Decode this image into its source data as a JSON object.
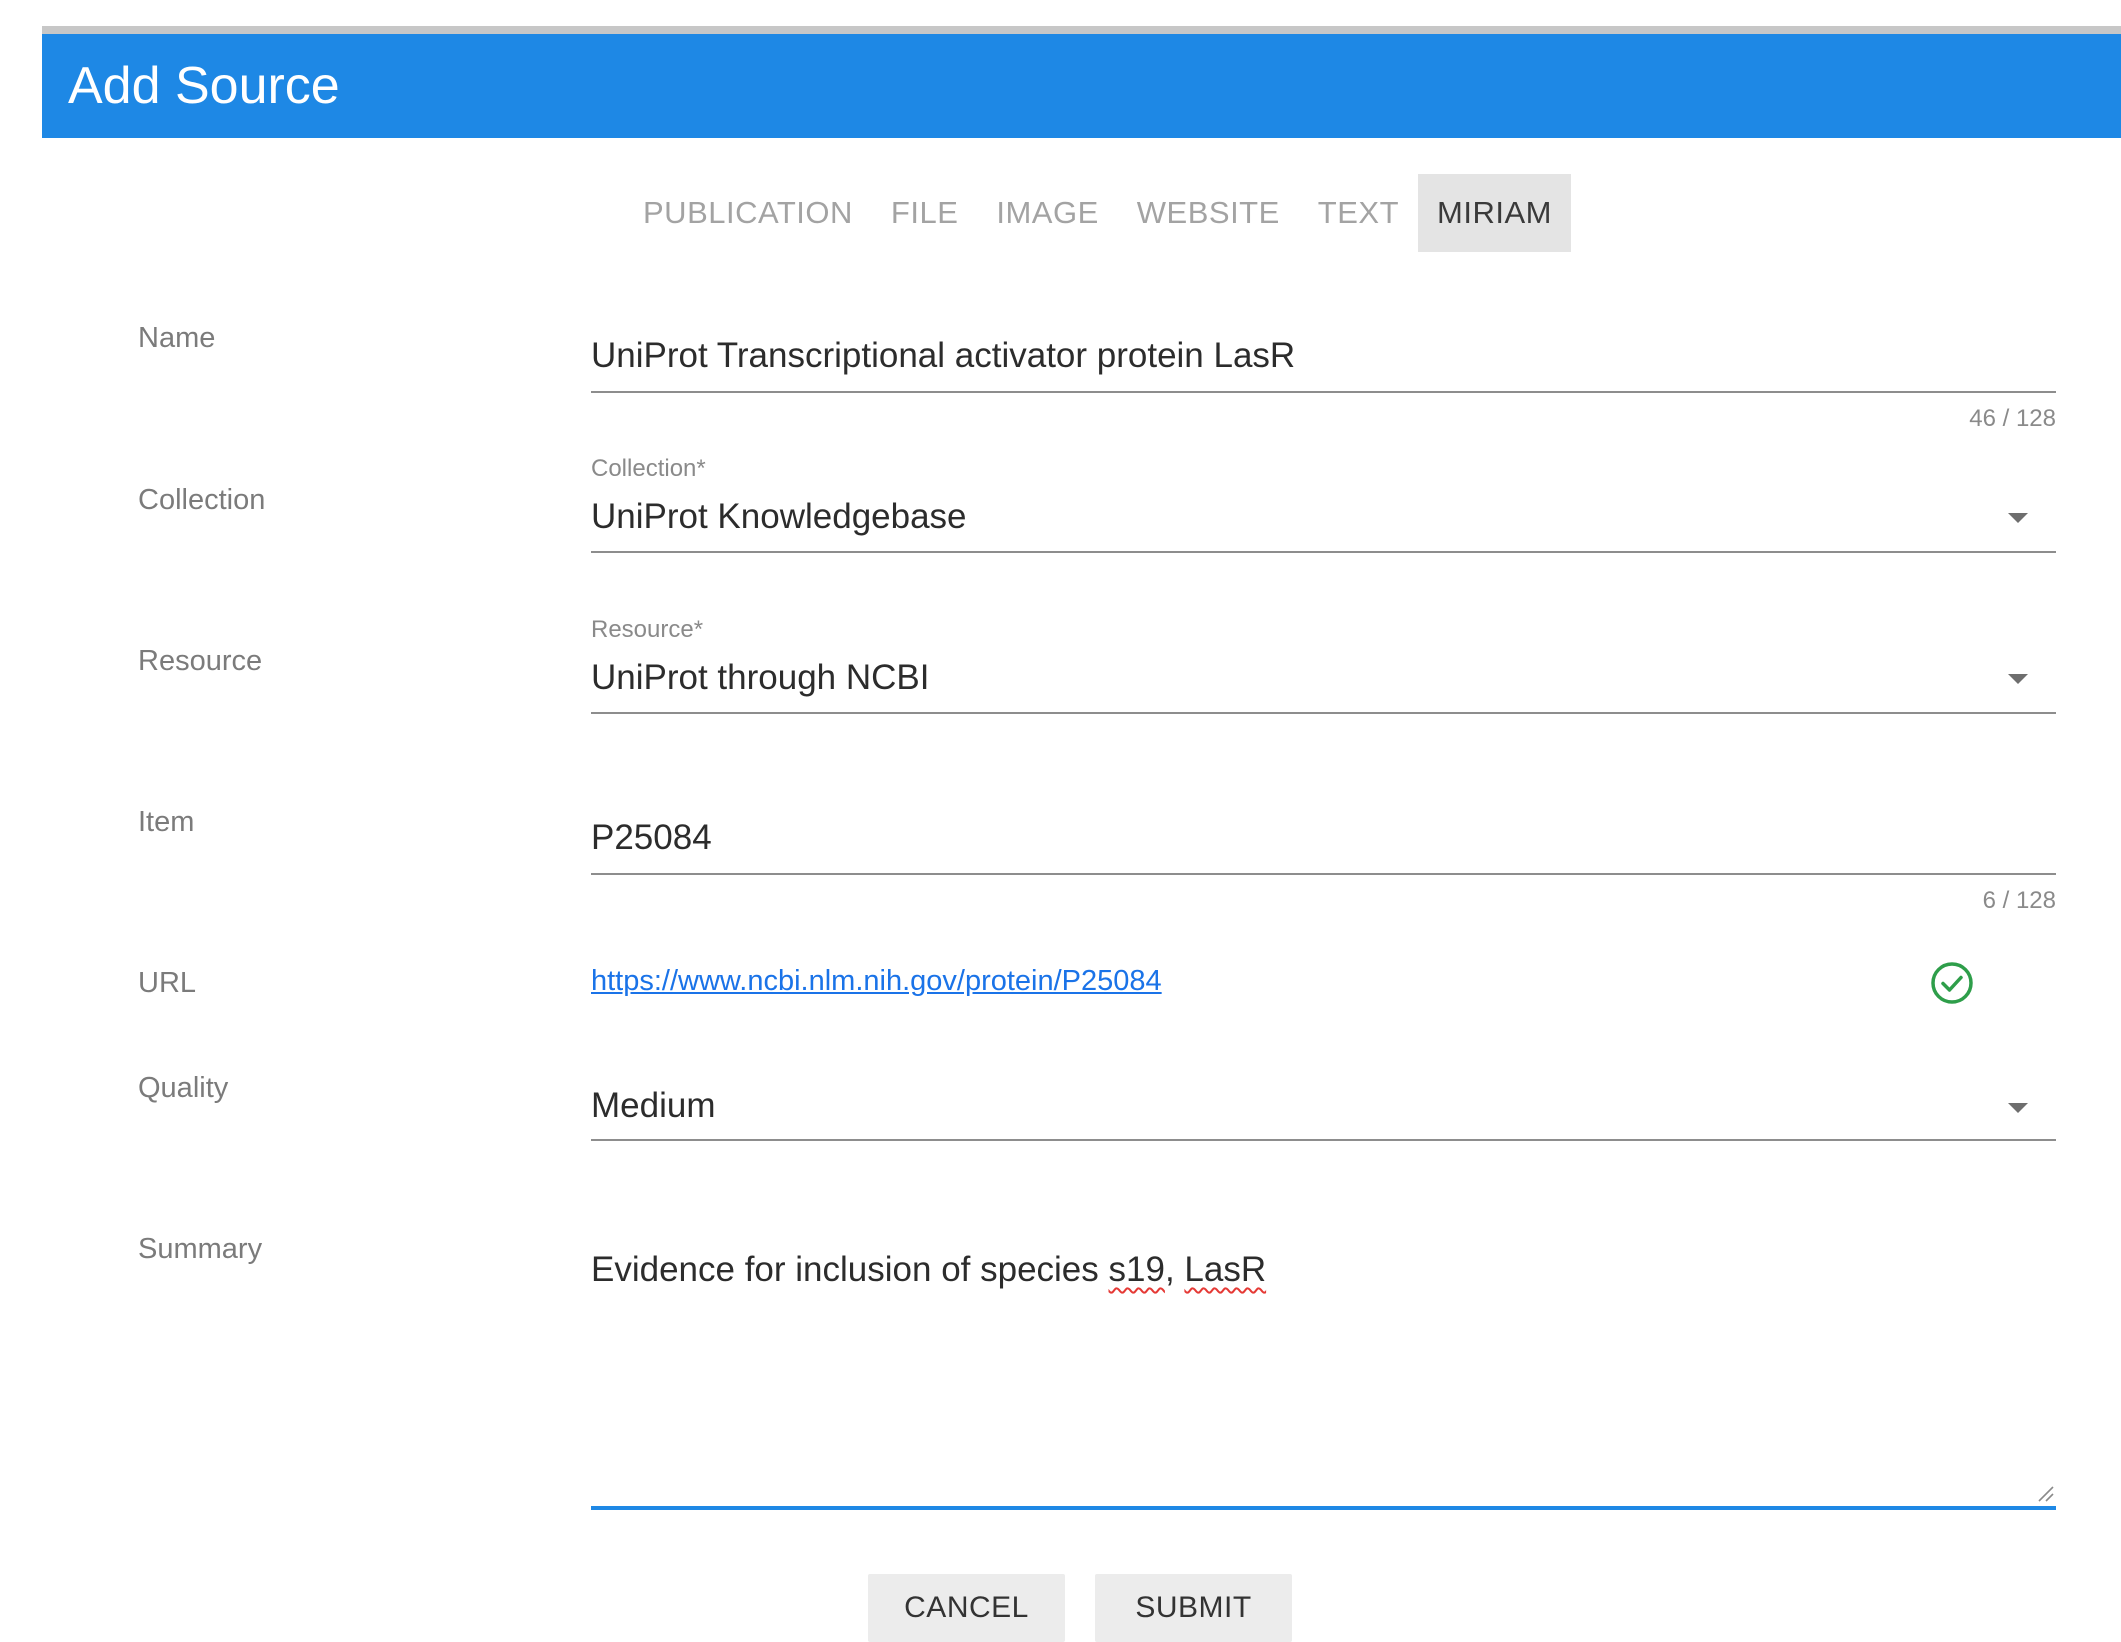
{
  "dialog": {
    "title": "Add Source"
  },
  "tabs": [
    {
      "label": "PUBLICATION",
      "active": false
    },
    {
      "label": "FILE",
      "active": false
    },
    {
      "label": "IMAGE",
      "active": false
    },
    {
      "label": "WEBSITE",
      "active": false
    },
    {
      "label": "TEXT",
      "active": false
    },
    {
      "label": "MIRIAM",
      "active": true
    }
  ],
  "form": {
    "name": {
      "label": "Name",
      "value": "UniProt Transcriptional activator protein LasR",
      "counter": "46 / 128"
    },
    "collection": {
      "label": "Collection",
      "floating_label": "Collection*",
      "value": "UniProt Knowledgebase"
    },
    "resource": {
      "label": "Resource",
      "floating_label": "Resource*",
      "value": "UniProt through NCBI"
    },
    "item": {
      "label": "Item",
      "value": "P25084",
      "counter": "6 / 128"
    },
    "url": {
      "label": "URL",
      "value": "https://www.ncbi.nlm.nih.gov/protein/P25084",
      "status_icon": "check-circle-icon",
      "status_color": "#2e9e4a"
    },
    "quality": {
      "label": "Quality",
      "value": "Medium"
    },
    "summary": {
      "label": "Summary",
      "text_prefix": "Evidence for inclusion of species ",
      "text_flagged_1": "s19",
      "text_separator": ", ",
      "text_flagged_2": "LasR"
    }
  },
  "actions": {
    "cancel_label": "CANCEL",
    "submit_label": "SUBMIT"
  },
  "colors": {
    "header": "#1e88e5",
    "link": "#1a73e8",
    "active_tab_bg": "#e4e4e4",
    "focus_underline": "#1e88e5",
    "spellcheck": "#e53935"
  }
}
